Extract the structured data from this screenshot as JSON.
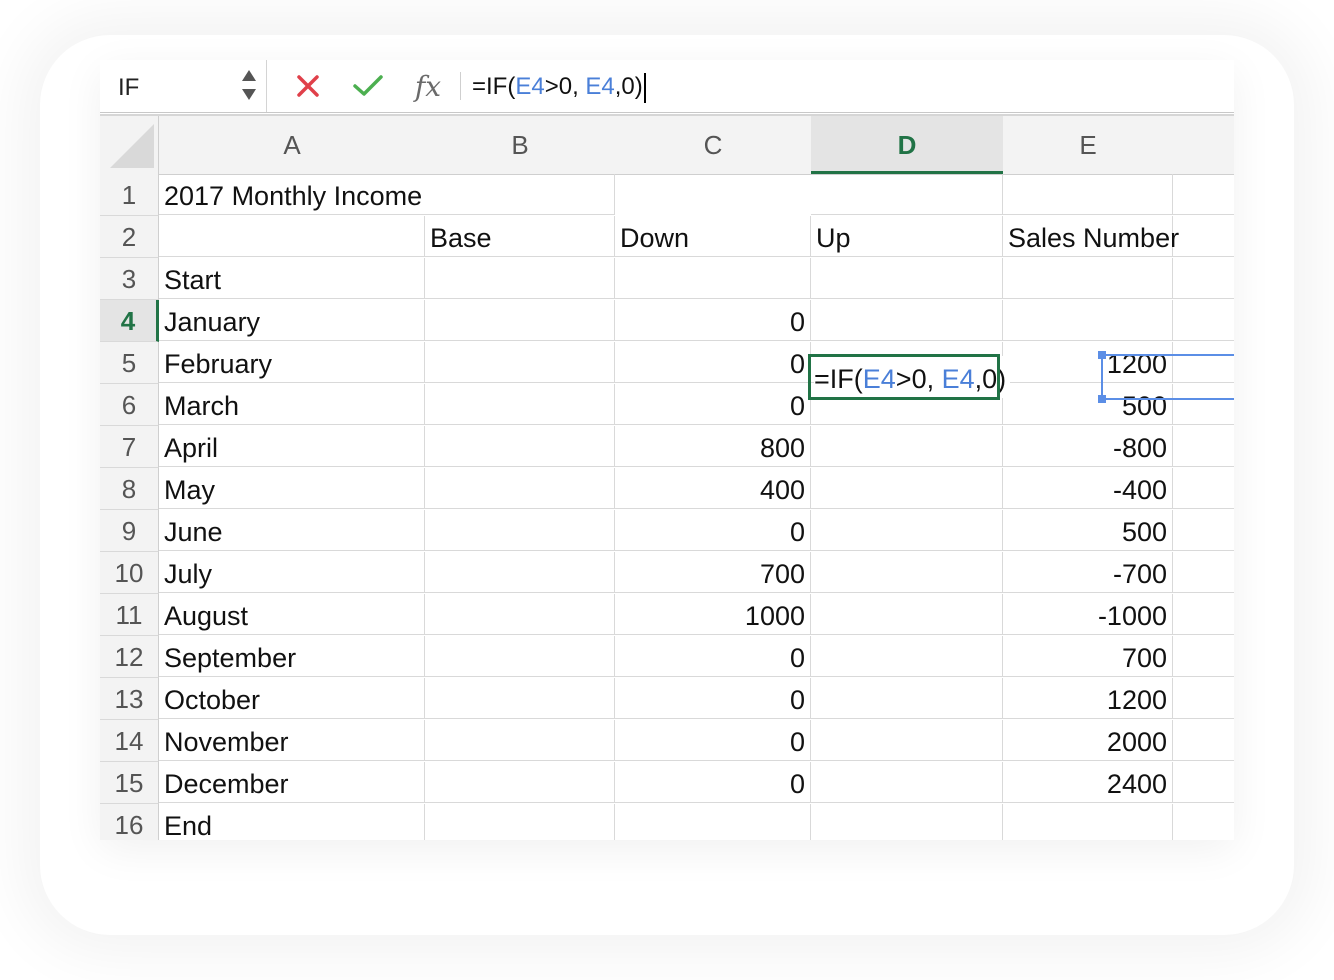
{
  "formula_bar": {
    "name_box": "IF",
    "cancel_icon": "x-icon",
    "accept_icon": "check-icon",
    "fx_label": "fx",
    "formula_prefix": "=IF(",
    "formula_ref1": "E4",
    "formula_mid": ">0, ",
    "formula_ref2": "E4",
    "formula_suffix": ",0)"
  },
  "columns": [
    "A",
    "B",
    "C",
    "D",
    "E"
  ],
  "active_column": "D",
  "active_row": "4",
  "title": "2017 Monthly Income",
  "headers": {
    "b": "Base",
    "c": "Down",
    "d": "Up",
    "e": "Sales Number"
  },
  "rows": [
    {
      "n": "3",
      "a": "Start",
      "c": "",
      "e": ""
    },
    {
      "n": "4",
      "a": "January",
      "c": "0",
      "e": ""
    },
    {
      "n": "5",
      "a": "February",
      "c": "0",
      "e": "1200"
    },
    {
      "n": "6",
      "a": "March",
      "c": "0",
      "e": "500"
    },
    {
      "n": "7",
      "a": "April",
      "c": "800",
      "e": "-800"
    },
    {
      "n": "8",
      "a": "May",
      "c": "400",
      "e": "-400"
    },
    {
      "n": "9",
      "a": "June",
      "c": "0",
      "e": "500"
    },
    {
      "n": "10",
      "a": "July",
      "c": "700",
      "e": "-700"
    },
    {
      "n": "11",
      "a": "August",
      "c": "1000",
      "e": "-1000"
    },
    {
      "n": "12",
      "a": "September",
      "c": "0",
      "e": "700"
    },
    {
      "n": "13",
      "a": "October",
      "c": "0",
      "e": "1200"
    },
    {
      "n": "14",
      "a": "November",
      "c": "0",
      "e": "2000"
    },
    {
      "n": "15",
      "a": "December",
      "c": "0",
      "e": "2400"
    },
    {
      "n": "16",
      "a": "End",
      "c": "",
      "e": ""
    }
  ],
  "row_numbers": {
    "r1": "1",
    "r2": "2"
  },
  "colors": {
    "accent_green": "#217346",
    "reference_blue": "#4a7fd8",
    "cancel_red": "#e0404a",
    "accept_green": "#4caf50"
  }
}
